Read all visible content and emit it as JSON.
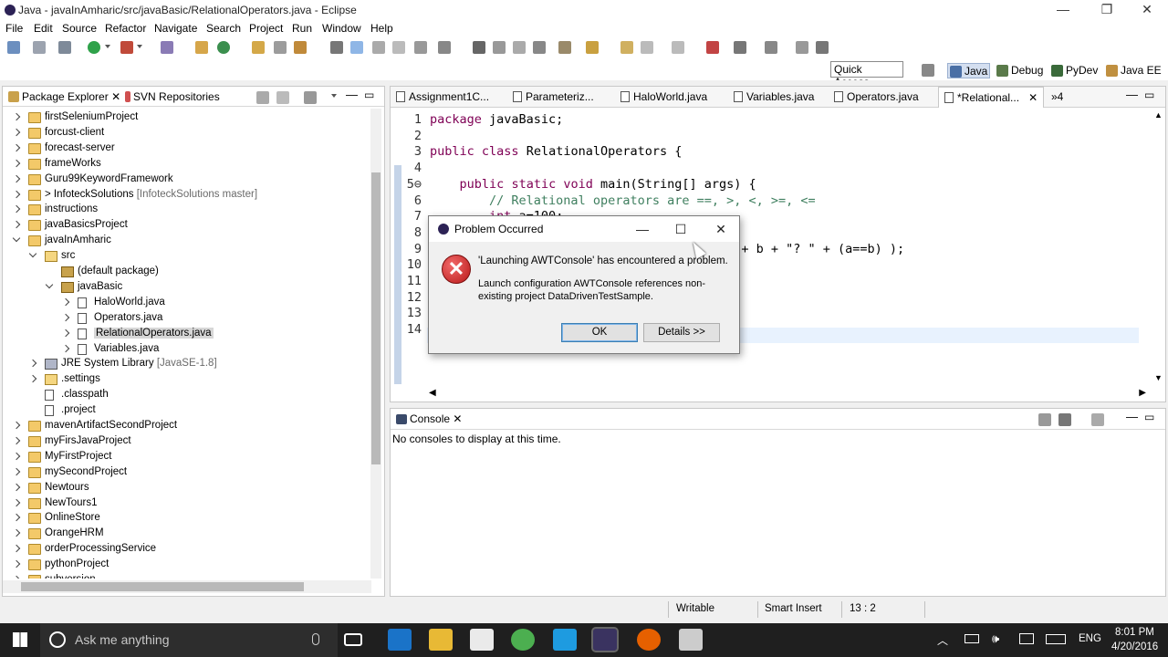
{
  "window": {
    "title": "Java - javaInAmharic/src/javaBasic/RelationalOperators.java - Eclipse",
    "minimize": "—",
    "maximize": "❐",
    "close": "✕"
  },
  "menu": [
    "File",
    "Edit",
    "Source",
    "Refactor",
    "Navigate",
    "Search",
    "Project",
    "Run",
    "Window",
    "Help"
  ],
  "quick_access": "Quick Access",
  "perspectives": [
    "Java",
    "Debug",
    "PyDev",
    "Java EE"
  ],
  "package_explorer": {
    "tabs": [
      "Package Explorer",
      "SVN Repositories"
    ],
    "items": [
      {
        "label": "firstSeleniumProject",
        "extra": ""
      },
      {
        "label": "forcust-client",
        "extra": ""
      },
      {
        "label": "forecast-server",
        "extra": ""
      },
      {
        "label": "frameWorks",
        "extra": ""
      },
      {
        "label": "Guru99KeywordFramework",
        "extra": ""
      },
      {
        "label": "> InfoteckSolutions",
        "extra": "[InfoteckSolutions master]"
      },
      {
        "label": "instructions",
        "extra": ""
      },
      {
        "label": "javaBasicsProject",
        "extra": ""
      },
      {
        "label": "javaInAmharic",
        "extra": ""
      },
      {
        "label": "src",
        "extra": ""
      },
      {
        "label": "(default package)",
        "extra": ""
      },
      {
        "label": "javaBasic",
        "extra": ""
      },
      {
        "label": "HaloWorld.java",
        "extra": ""
      },
      {
        "label": "Operators.java",
        "extra": ""
      },
      {
        "label": "RelationalOperators.java",
        "extra": ""
      },
      {
        "label": "Variables.java",
        "extra": ""
      },
      {
        "label": "JRE System Library",
        "extra": "[JavaSE-1.8]"
      },
      {
        "label": ".settings",
        "extra": ""
      },
      {
        "label": ".classpath",
        "extra": ""
      },
      {
        "label": ".project",
        "extra": ""
      },
      {
        "label": "mavenArtifactSecondProject",
        "extra": ""
      },
      {
        "label": "myFirsJavaProject",
        "extra": ""
      },
      {
        "label": "MyFirstProject",
        "extra": ""
      },
      {
        "label": "mySecondProject",
        "extra": ""
      },
      {
        "label": "Newtours",
        "extra": ""
      },
      {
        "label": "NewTours1",
        "extra": ""
      },
      {
        "label": "OnlineStore",
        "extra": ""
      },
      {
        "label": "OrangeHRM",
        "extra": ""
      },
      {
        "label": "orderProcessingService",
        "extra": ""
      },
      {
        "label": "pythonProject",
        "extra": ""
      },
      {
        "label": "subversion",
        "extra": ""
      }
    ]
  },
  "editor": {
    "tabs": [
      "Assignment1C...",
      "Parameteriz...",
      "HaloWorld.java",
      "Variables.java",
      "Operators.java",
      "*Relational...",
      "»4"
    ],
    "lines": [
      {
        "n": "1",
        "code": "package javaBasic;"
      },
      {
        "n": "2",
        "code": ""
      },
      {
        "n": "3",
        "code": "public class RelationalOperators {"
      },
      {
        "n": "4",
        "code": ""
      },
      {
        "n": "5⊖",
        "code": "    public static void main(String[] args) {"
      },
      {
        "n": "6",
        "code": "        // Relational operators are ==, >, <, >=, <="
      },
      {
        "n": "7",
        "code": "        int a=100;"
      },
      {
        "n": "8",
        "code": ""
      },
      {
        "n": "9",
        "code": "                                    +\" = \"+ b + \"? \" + (a==b) );"
      },
      {
        "n": "10",
        "code": ""
      },
      {
        "n": "11",
        "code": ""
      },
      {
        "n": "12",
        "code": ""
      },
      {
        "n": "13",
        "code": ""
      },
      {
        "n": "14",
        "code": ""
      }
    ]
  },
  "console": {
    "tab": "Console",
    "message": "No consoles to display at this time."
  },
  "status": {
    "writable": "Writable",
    "insert_mode": "Smart Insert",
    "position": "13 : 2"
  },
  "dialog": {
    "title": "Problem Occurred",
    "message": "'Launching AWTConsole' has encountered a problem.",
    "detail": "Launch configuration AWTConsole references non-existing project DataDrivenTestSample.",
    "ok": "OK",
    "details": "Details >>"
  },
  "taskbar": {
    "search_placeholder": "Ask me anything",
    "language": "ENG",
    "time": "8:01 PM",
    "date": "4/20/2016"
  }
}
